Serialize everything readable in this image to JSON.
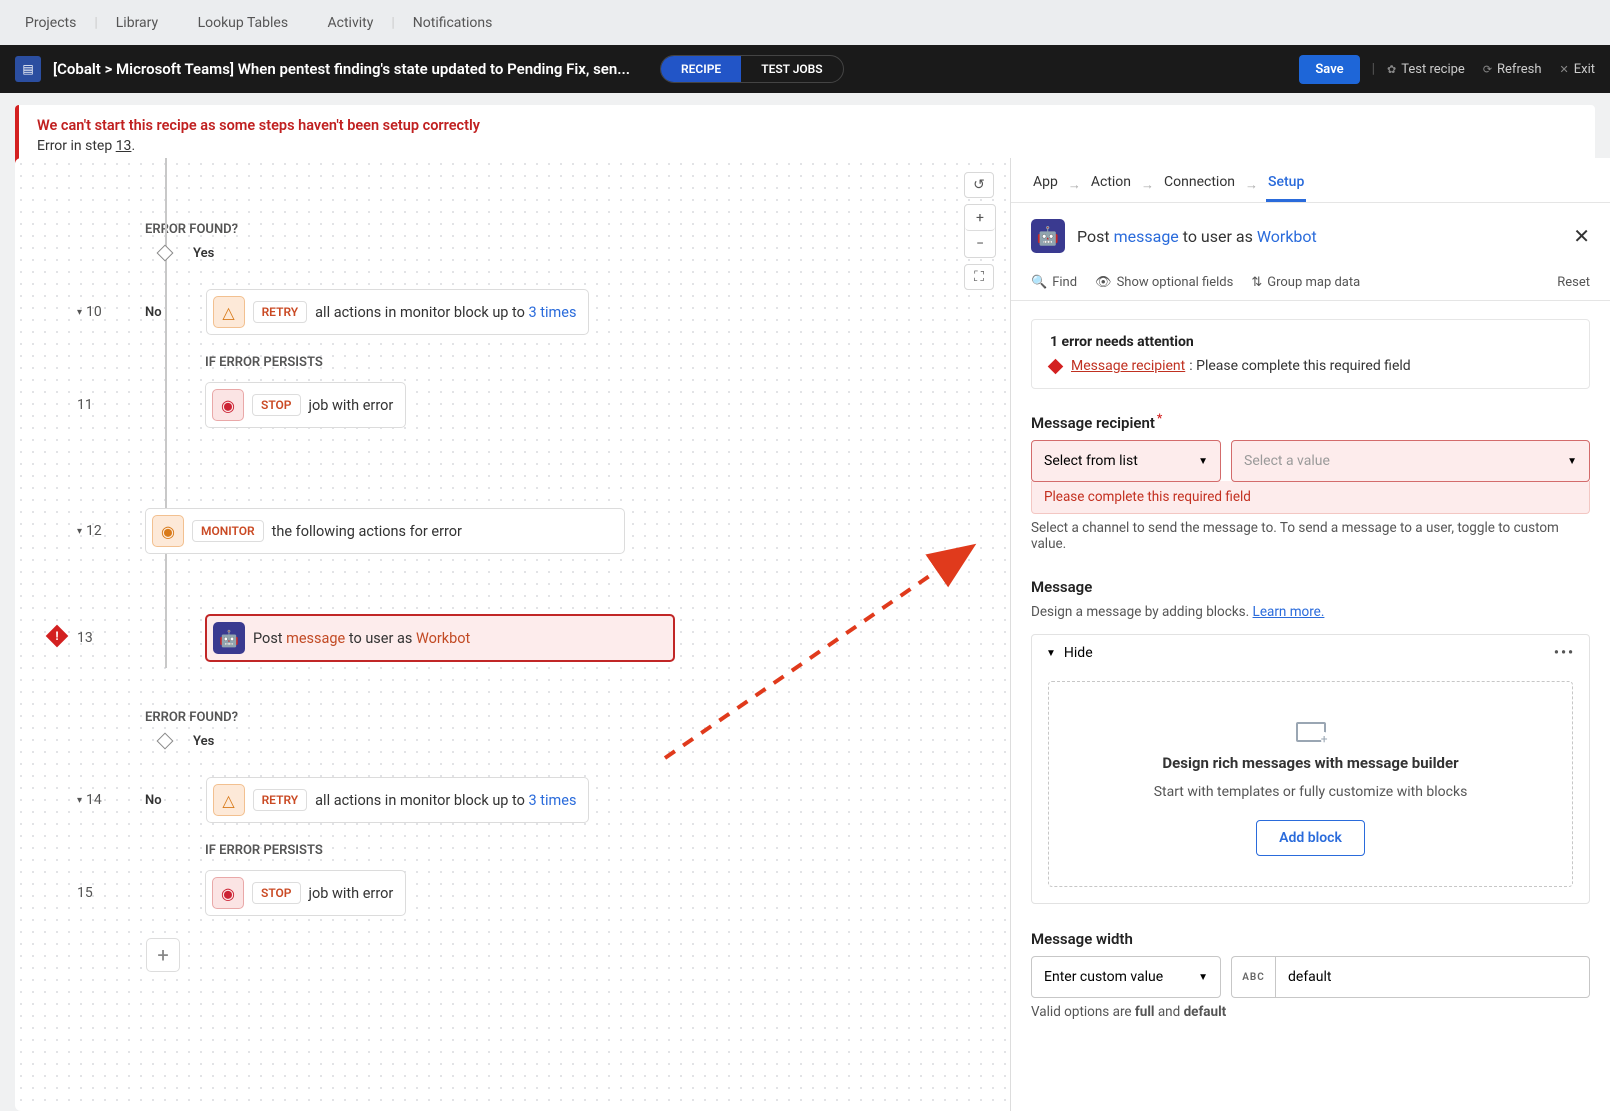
{
  "nav": [
    "Projects",
    "Library",
    "Lookup Tables",
    "Activity",
    "Notifications"
  ],
  "header": {
    "title": "[Cobalt > Microsoft Teams] When pentest finding's state updated to Pending Fix, sen...",
    "toggle": {
      "recipe": "RECIPE",
      "test": "TEST JOBS"
    },
    "save": "Save",
    "test": "Test recipe",
    "refresh": "Refresh",
    "exit": "Exit"
  },
  "banner": {
    "line1": "We can't start this recipe as some steps haven't been setup correctly",
    "line2_prefix": "Error in step ",
    "line2_link": "13"
  },
  "canvas": {
    "errorFound": "ERROR FOUND?",
    "yes": "Yes",
    "no": "No",
    "retry": "RETRY",
    "retryText": "all actions in monitor block up to ",
    "retryLink": "3 times",
    "persists": "IF ERROR PERSISTS",
    "stop": "STOP",
    "stopText": "job with error",
    "monitor": "MONITOR",
    "monitorText": "the following actions for error",
    "post_prefix": "Post ",
    "post_msg": "message",
    "post_mid": " to user as ",
    "post_bot": "Workbot",
    "steps": {
      "retry1": "10",
      "stop1": "11",
      "monitor": "12",
      "post": "13",
      "retry2": "14",
      "stop2": "15"
    }
  },
  "zoom": {
    "undo": "↺",
    "plus": "+",
    "minus": "−",
    "fit": "⛶"
  },
  "panel": {
    "tabs": [
      "App",
      "Action",
      "Connection",
      "Setup"
    ],
    "activeTab": 3,
    "ptitle": {
      "pre": "Post ",
      "msg": "message",
      "mid": " to user as ",
      "bot": "Workbot"
    },
    "tools": {
      "find": "Find",
      "opt": "Show optional fields",
      "map": "Group map data",
      "reset": "Reset"
    },
    "alert": {
      "heading": "1 error needs attention",
      "link": "Message recipient",
      "tail": ":   Please complete this required field"
    },
    "recipient": {
      "label": "Message recipient",
      "mode": "Select from list",
      "placeholder": "Select a value",
      "err": "Please complete this required field",
      "help": "Select a channel to send the message to. To send a message to a user, toggle to custom value."
    },
    "message": {
      "label": "Message",
      "help_pre": "Design a message by adding blocks. ",
      "help_link": "Learn more.",
      "hide": "Hide",
      "btitle": "Design rich messages with message builder",
      "bsub": "Start with templates or fully customize with blocks",
      "addblock": "Add block"
    },
    "width": {
      "label": "Message width",
      "mode": "Enter custom value",
      "value": "default",
      "help_pre": "Valid options are ",
      "full": "full",
      "and": " and ",
      "def": "default"
    }
  }
}
